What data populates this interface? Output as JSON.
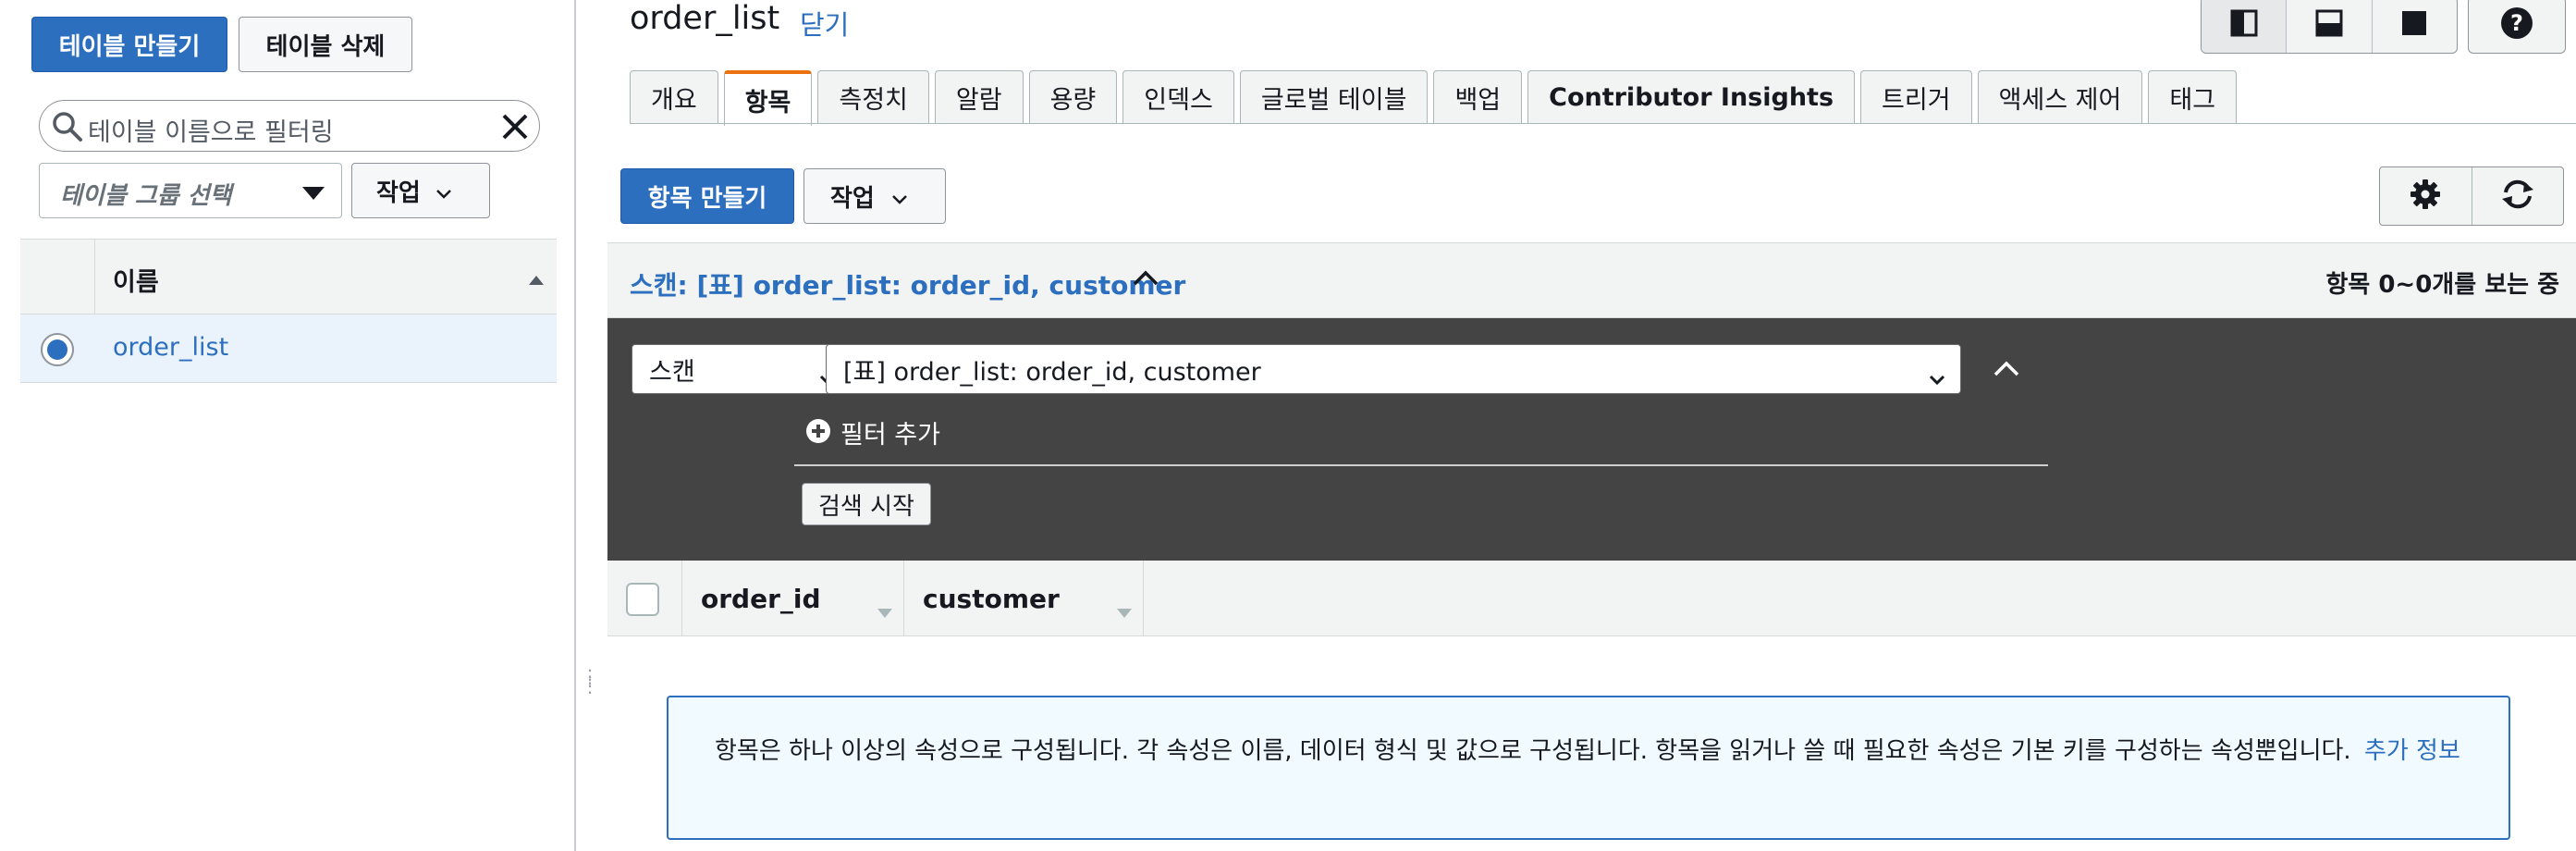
{
  "sidebar": {
    "create_table_label": "테이블 만들기",
    "delete_table_label": "테이블 삭제",
    "filter_placeholder": "테이블 이름으로 필터링",
    "group_select_placeholder": "테이블 그룹 선택",
    "actions_label": "작업",
    "table": {
      "header": "이름",
      "rows": [
        {
          "name": "order_list",
          "selected": true
        }
      ]
    }
  },
  "main": {
    "title": "order_list",
    "close_label": "닫기",
    "tabs": [
      {
        "label": "개요",
        "active": false
      },
      {
        "label": "항목",
        "active": true
      },
      {
        "label": "측정치",
        "active": false
      },
      {
        "label": "알람",
        "active": false
      },
      {
        "label": "용량",
        "active": false
      },
      {
        "label": "인덱스",
        "active": false
      },
      {
        "label": "글로벌 테이블",
        "active": false
      },
      {
        "label": "백업",
        "active": false
      },
      {
        "label": "Contributor Insights",
        "active": false
      },
      {
        "label": "트리거",
        "active": false
      },
      {
        "label": "액세스 제어",
        "active": false
      },
      {
        "label": "태그",
        "active": false
      }
    ],
    "create_item_label": "항목 만들기",
    "actions_label": "작업",
    "scan_title": "스캔: [표] order_list: order_id, customer",
    "count_text": "항목 0~0개를 보는 중",
    "scan_type_value": "스캔",
    "scan_target_value": "[표] order_list: order_id, customer",
    "add_filter_label": "필터 추가",
    "start_search_label": "검색 시작",
    "columns": [
      "order_id",
      "customer"
    ],
    "info_text": "항목은 하나 이상의 속성으로 구성됩니다. 각 속성은 이름, 데이터 형식 및 값으로 구성됩니다. 항목을 읽거나 쓸 때 필요한 속성은 기본 키를 구성하는 속성뿐입니다.",
    "info_link": "추가 정보"
  },
  "colors": {
    "primary": "#2d6fbf",
    "active_tab_accent": "#ec7211",
    "dark_panel": "#444444",
    "info_bg": "#f1faff"
  },
  "icons": [
    "search-icon",
    "clear-icon",
    "caret-down-icon",
    "chevron-down-icon",
    "sort-up-icon",
    "layout-split-vertical-icon",
    "layout-split-horizontal-icon",
    "layout-full-icon",
    "help-icon",
    "gear-icon",
    "refresh-icon",
    "chevron-up-icon",
    "plus-circle-icon",
    "sort-down-icon",
    "resize-grip-icon"
  ]
}
